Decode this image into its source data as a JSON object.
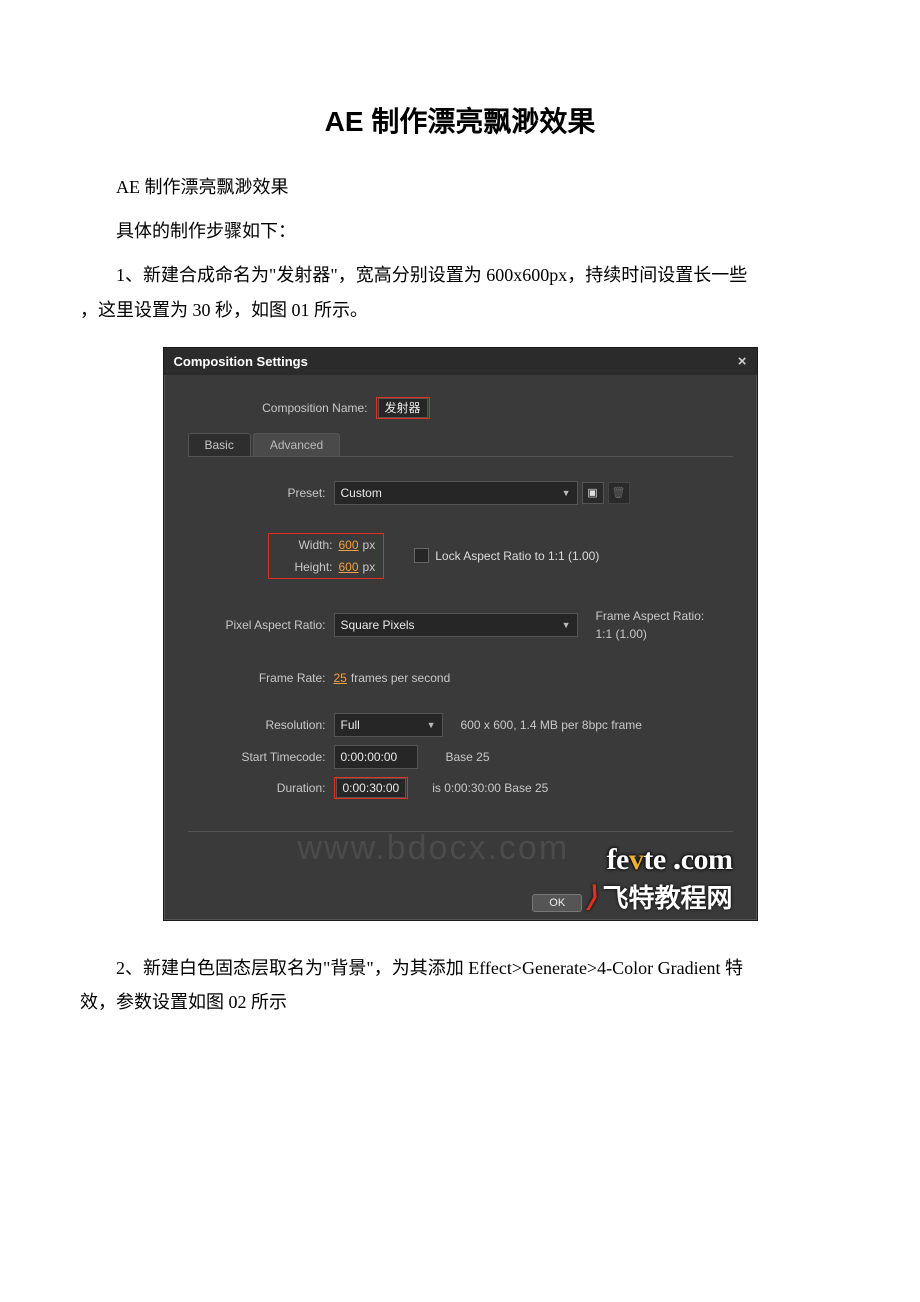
{
  "doc": {
    "title": "AE 制作漂亮飘渺效果",
    "p1": "AE 制作漂亮飘渺效果",
    "p2": "具体的制作步骤如下：",
    "p3a": "1、新建合成命名为\"发射器\"，宽高分别设置为 600x600px，持续时间设置长一些",
    "p3b": "，这里设置为 30 秒，如图 01 所示。",
    "p4a": "2、新建白色固态层取名为\"背景\"，为其添加 Effect>Generate>4-Color Gradient 特",
    "p4b": "效，参数设置如图 02 所示"
  },
  "dlg": {
    "title": "Composition Settings",
    "close": "×",
    "comp_name_label": "Composition Name:",
    "comp_name_value": "发射器",
    "tab_basic": "Basic",
    "tab_advanced": "Advanced",
    "preset_label": "Preset:",
    "preset_value": "Custom",
    "width_label": "Width:",
    "width_value": "600",
    "width_unit": "px",
    "height_label": "Height:",
    "height_value": "600",
    "height_unit": "px",
    "lock_label": "Lock Aspect Ratio to 1:1 (1.00)",
    "par_label": "Pixel Aspect Ratio:",
    "par_value": "Square Pixels",
    "far_label": "Frame Aspect Ratio:",
    "far_value": "1:1 (1.00)",
    "fr_label": "Frame Rate:",
    "fr_value": "25",
    "fr_unit": "frames per second",
    "res_label": "Resolution:",
    "res_value": "Full",
    "res_info": "600 x 600, 1.4 MB per 8bpc frame",
    "stc_label": "Start Timecode:",
    "stc_value": "0:00:00:00",
    "stc_info": "Base 25",
    "dur_label": "Duration:",
    "dur_value": "0:00:30:00",
    "dur_info": "is 0:00:30:00  Base 25",
    "ok": "OK",
    "wm_bg": "www.bdocx.com",
    "wm_site": "fevte .com",
    "wm_cn": "飞特教程网"
  }
}
